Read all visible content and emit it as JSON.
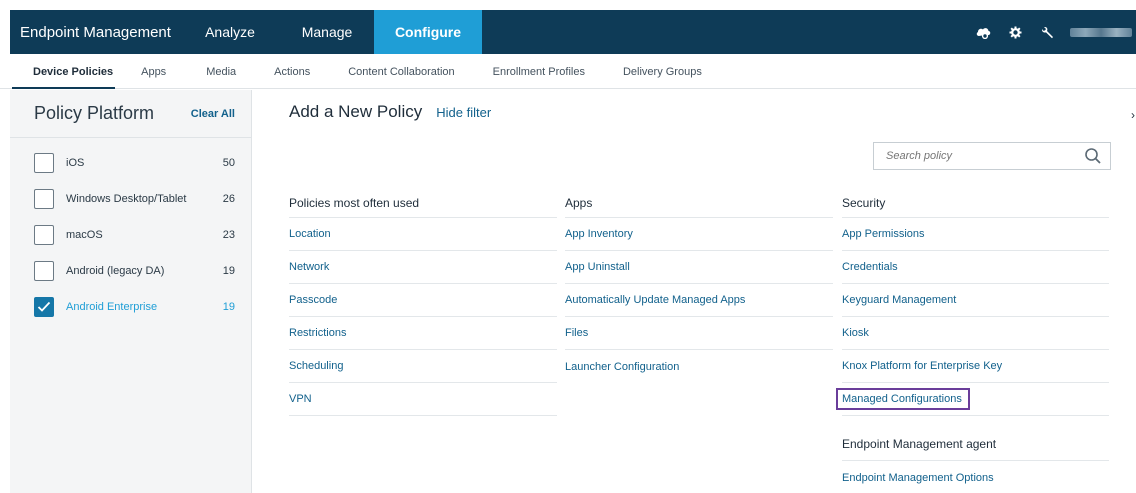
{
  "topnav": {
    "brand": "Endpoint Management",
    "items": [
      "Analyze",
      "Manage",
      "Configure"
    ],
    "active": "Configure",
    "icons": [
      "cloud-gear-icon",
      "gear-icon",
      "wrench-icon"
    ]
  },
  "subtabs": [
    "Device Policies",
    "Apps",
    "Media",
    "Actions",
    "Content Collaboration",
    "Enrollment Profiles",
    "Delivery Groups"
  ],
  "sidebar": {
    "title": "Policy Platform",
    "clear_all": "Clear All",
    "platforms": [
      {
        "label": "iOS",
        "count": "50",
        "checked": false
      },
      {
        "label": "Windows Desktop/Tablet",
        "count": "26",
        "checked": false
      },
      {
        "label": "macOS",
        "count": "23",
        "checked": false
      },
      {
        "label": "Android (legacy DA)",
        "count": "19",
        "checked": false
      },
      {
        "label": "Android Enterprise",
        "count": "19",
        "checked": true
      }
    ]
  },
  "main": {
    "title": "Add a New Policy",
    "hide_filter": "Hide filter",
    "search_placeholder": "Search policy",
    "columns": [
      {
        "heading": "Policies most often used",
        "links": [
          "Location",
          "Network",
          "Passcode",
          "Restrictions",
          "Scheduling",
          "VPN"
        ]
      },
      {
        "heading": "Apps",
        "links": [
          "App Inventory",
          "App Uninstall",
          "Automatically Update Managed Apps",
          "Files",
          "Launcher Configuration"
        ]
      },
      {
        "heading": "Security",
        "links": [
          "App Permissions",
          "Credentials",
          "Keyguard Management",
          "Kiosk",
          "Knox Platform for Enterprise Key",
          "Managed Configurations"
        ],
        "highlighted": "Managed Configurations",
        "highlight_color": "#6a3d9a",
        "sub_heading": "Endpoint Management agent",
        "sub_links": [
          "Endpoint Management Options"
        ]
      }
    ]
  },
  "colors": {
    "nav_bg": "#0e3b57",
    "nav_active": "#1f9ed6",
    "link": "#12618c",
    "checkbox_checked": "#1577a8"
  }
}
